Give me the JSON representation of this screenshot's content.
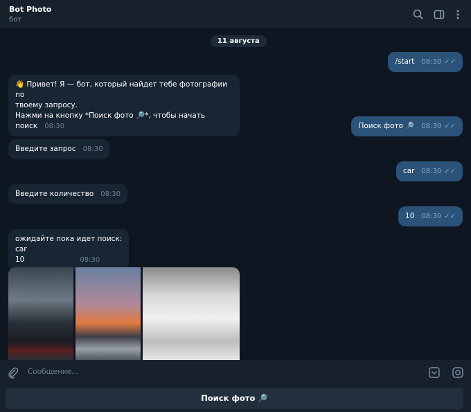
{
  "header": {
    "title": "Bot Photo",
    "subtitle": "бот"
  },
  "date": "11 августа",
  "messages": [
    {
      "dir": "out",
      "text": "/start",
      "time": "08:30"
    },
    {
      "dir": "in",
      "lines": [
        "👋 Привет! Я — бот, который найдет тебе фотографии по",
        "твоему запросу.",
        "Нажми на кнопку *Поиск фото 🔎*, чтобы начать поиск"
      ],
      "time": "08:30"
    },
    {
      "dir": "out",
      "text": "Поиск фото 🔎",
      "time": "08:30"
    },
    {
      "dir": "in",
      "text": "Введите запрос",
      "time": "08:30"
    },
    {
      "dir": "out",
      "text": "car",
      "time": "08:30"
    },
    {
      "dir": "in",
      "text": "Введите количество",
      "time": "08:30"
    },
    {
      "dir": "out",
      "text": "10",
      "time": "08:30"
    },
    {
      "dir": "in",
      "lines": [
        "ожидайте пока идет поиск:",
        "car",
        "10"
      ],
      "time": "08:30"
    }
  ],
  "input": {
    "placeholder": "Сообщение..."
  },
  "keyboard": {
    "button": "Поиск фото 🔎"
  }
}
